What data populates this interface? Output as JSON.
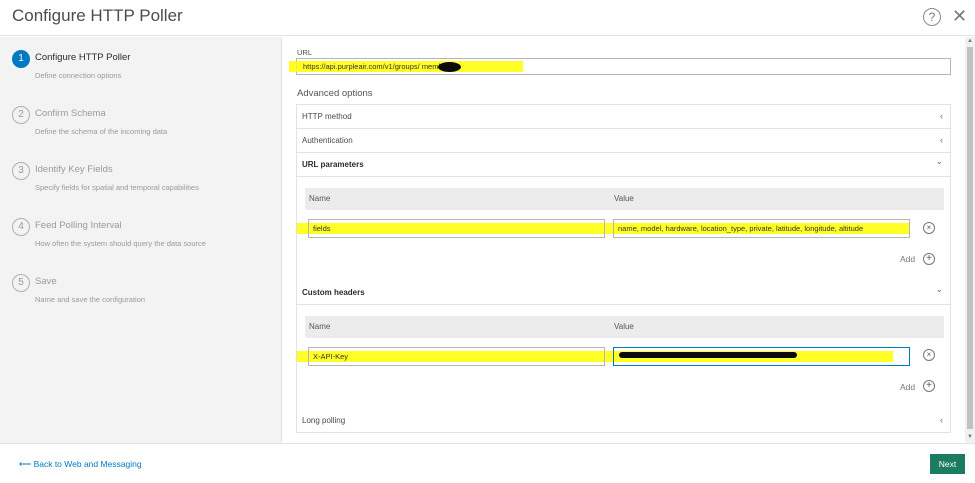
{
  "window": {
    "title": "Configure HTTP Poller"
  },
  "steps": [
    {
      "num": "1",
      "title": "Configure HTTP Poller",
      "desc": "Define connection options"
    },
    {
      "num": "2",
      "title": "Confirm Schema",
      "desc": "Define the schema of the incoming data"
    },
    {
      "num": "3",
      "title": "Identify Key Fields",
      "desc": "Specify fields for spatial and temporal capabilities"
    },
    {
      "num": "4",
      "title": "Feed Polling Interval",
      "desc": "How often the system should query the data source"
    },
    {
      "num": "5",
      "title": "Save",
      "desc": "Name and save the configuration"
    }
  ],
  "url": {
    "label": "URL",
    "value": "https://api.purpleair.com/v1/groups/       members"
  },
  "advanced": {
    "label": "Advanced options",
    "http_method": "HTTP method",
    "authentication": "Authentication",
    "url_parameters": "URL parameters",
    "custom_headers": "Custom headers",
    "long_polling": "Long polling"
  },
  "url_params_table": {
    "name_header": "Name",
    "value_header": "Value",
    "rows": [
      {
        "name": "fields",
        "value": "name, model, hardware, location_type, private, latitude, longitude, altitude"
      }
    ],
    "add_label": "Add"
  },
  "headers_table": {
    "name_header": "Name",
    "value_header": "Value",
    "rows": [
      {
        "name": "X-API-Key",
        "value": ""
      }
    ],
    "add_label": "Add"
  },
  "footer": {
    "back_label": "Back to Web and Messaging",
    "next_label": "Next"
  },
  "icons": {
    "help": "?",
    "close": "✕",
    "back_arrow": "⟵",
    "chevron_left": "‹",
    "chevron_down": "⌄",
    "remove": "×",
    "add": "+"
  },
  "colors": {
    "accent": "#0079c1",
    "next_button": "#1c7c60",
    "highlight": "#ffff00"
  }
}
